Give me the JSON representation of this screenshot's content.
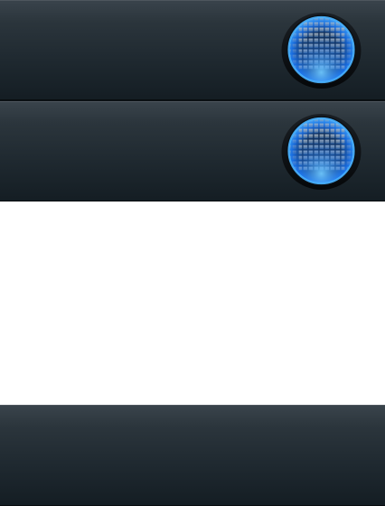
{
  "colors": {
    "panel_top": "#3a444c",
    "panel_bottom": "#141d23",
    "orb_glow": "#2a8cff",
    "orb_core": "#0a1a30",
    "grid": "#9aa6b2",
    "page_background": "#ffffff"
  },
  "panels": [
    {
      "button_icon": "blue-grid-orb-icon"
    },
    {
      "button_icon": "blue-grid-orb-icon"
    },
    {
      "button_icon": null
    }
  ]
}
